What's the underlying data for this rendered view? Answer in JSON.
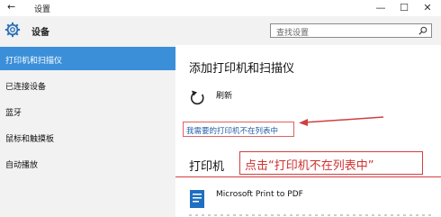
{
  "window": {
    "title": "设置",
    "back_glyph": "←",
    "minimize_glyph": "—",
    "maximize_glyph": "☐",
    "close_glyph": "✕"
  },
  "header": {
    "title": "设备",
    "icon": "gear-icon",
    "search_placeholder": "查找设置"
  },
  "sidebar": {
    "items": [
      {
        "label": "打印机和扫描仪",
        "active": true
      },
      {
        "label": "已连接设备",
        "active": false
      },
      {
        "label": "蓝牙",
        "active": false
      },
      {
        "label": "鼠标和触摸板",
        "active": false
      },
      {
        "label": "自动播放",
        "active": false
      }
    ]
  },
  "main": {
    "heading": "添加打印机和扫描仪",
    "refresh_label": "刷新",
    "not_listed_link": "我需要的打印机不在列表中",
    "printers_heading": "打印机",
    "printers": [
      {
        "name": "Microsoft Print to PDF"
      }
    ]
  },
  "annotation": {
    "text": "点击“打印机不在列表中”"
  },
  "colors": {
    "accent": "#3a8fd8",
    "link": "#2360a6",
    "annotation": "#d03030",
    "sidebar_bg": "#f2f2f2"
  }
}
